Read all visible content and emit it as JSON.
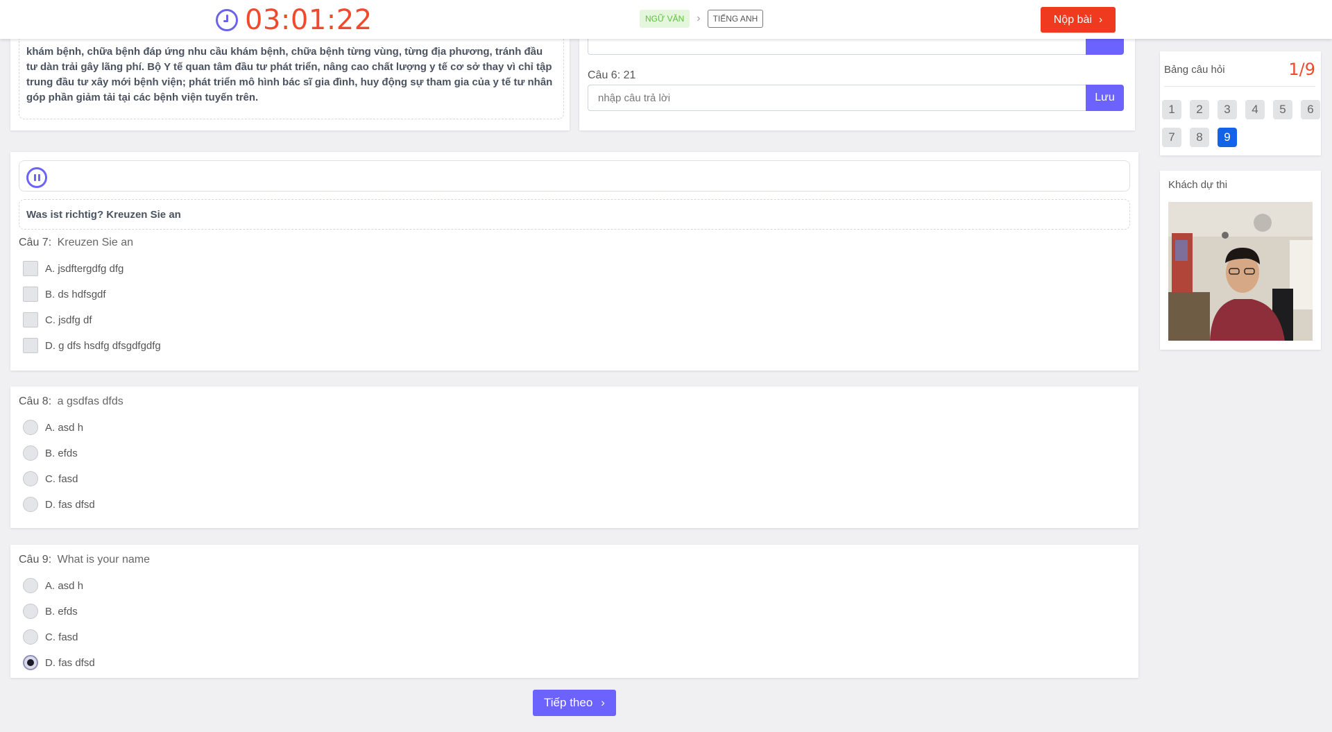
{
  "header": {
    "timer": "03:01:22",
    "crumbs": {
      "current": "NGỮ VĂN",
      "next": "TIẾNG ANH"
    },
    "submit_label": "Nộp bài"
  },
  "reading": {
    "text": "khám bệnh, chữa bệnh đáp ứng nhu cầu khám bệnh, chữa bệnh từng vùng, từng địa phương, tránh đầu tư dàn trải gây lãng phí. Bộ Y tế quan tâm đầu tư phát triển, nâng cao chất lượng y tế cơ sở thay vì chỉ tập trung đầu tư xây mới bệnh viện; phát triển mô hình bác sĩ gia đình, huy động sự tham gia của y tế tư nhân góp phần giảm tải tại các bệnh viện tuyến trên."
  },
  "q6": {
    "label": "Câu 6:",
    "text": "21",
    "placeholder": "nhập câu trả lời",
    "save_label": "Lưu"
  },
  "listening": {
    "instruction": "Was ist richtig? Kreuzen Sie an"
  },
  "q7": {
    "label": "Câu 7:",
    "text": "Kreuzen Sie an",
    "options": [
      "A.  jsdftergdfg dfg",
      "B.  ds hdfsgdf",
      "C.  jsdfg df",
      "D.  g dfs hsdfg dfsgdfgdfg"
    ]
  },
  "q8": {
    "label": "Câu 8:",
    "text": "a gsdfas dfds",
    "options": [
      "A.  asd h",
      "B.  efds",
      "C.  fasd",
      "D.  fas dfsd"
    ]
  },
  "q9": {
    "label": "Câu 9:",
    "text": "What is your name",
    "options": [
      "A.  asd h",
      "B.  efds",
      "C.  fasd",
      "D.  fas dfsd"
    ],
    "selected": "D"
  },
  "next_label": "Tiếp theo",
  "question_panel": {
    "title": "Bảng câu hỏi",
    "count": "1/9",
    "numbers": [
      "1",
      "2",
      "3",
      "4",
      "5",
      "6",
      "7",
      "8",
      "9"
    ],
    "active": "9"
  },
  "camera": {
    "title": "Khách dự thi"
  },
  "colors": {
    "accent": "#6c63ff",
    "danger": "#f03a20",
    "active_number": "#1363e8"
  }
}
